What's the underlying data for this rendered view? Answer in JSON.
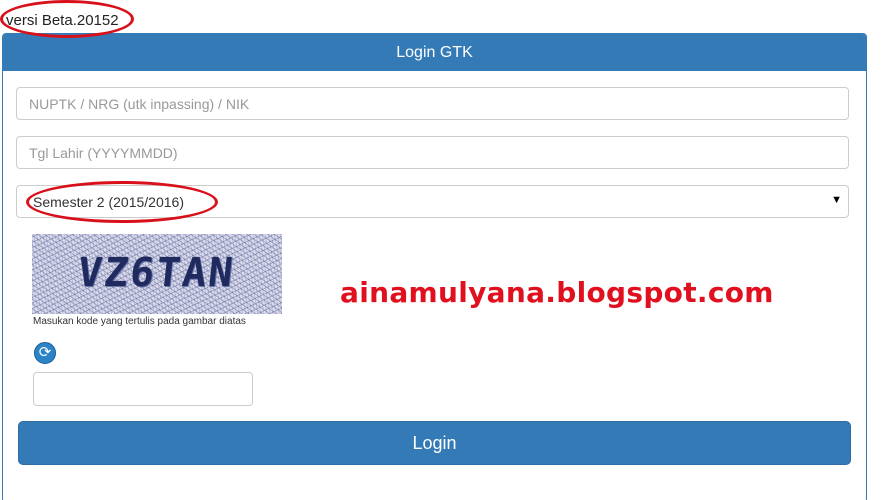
{
  "version_label": "versi Beta.20152",
  "panel": {
    "title": "Login GTK"
  },
  "form": {
    "nuptk_placeholder": "NUPTK / NRG (utk inpassing) / NIK",
    "tgl_lahir_placeholder": "Tgl Lahir (YYYYMMDD)",
    "semester_selected": "Semester 2 (2015/2016)",
    "captcha_text": "VZ6TAN",
    "captcha_hint": "Masukan kode yang tertulis pada gambar diatas",
    "login_button": "Login"
  },
  "icons": {
    "refresh": "refresh-icon",
    "dropdown": "dropdown-arrow-icon"
  },
  "watermark": "ainamulyana.blogspot.com",
  "colors": {
    "primary": "#337ab7",
    "annotation_red": "#d8101a",
    "watermark_red": "#e0101e"
  }
}
